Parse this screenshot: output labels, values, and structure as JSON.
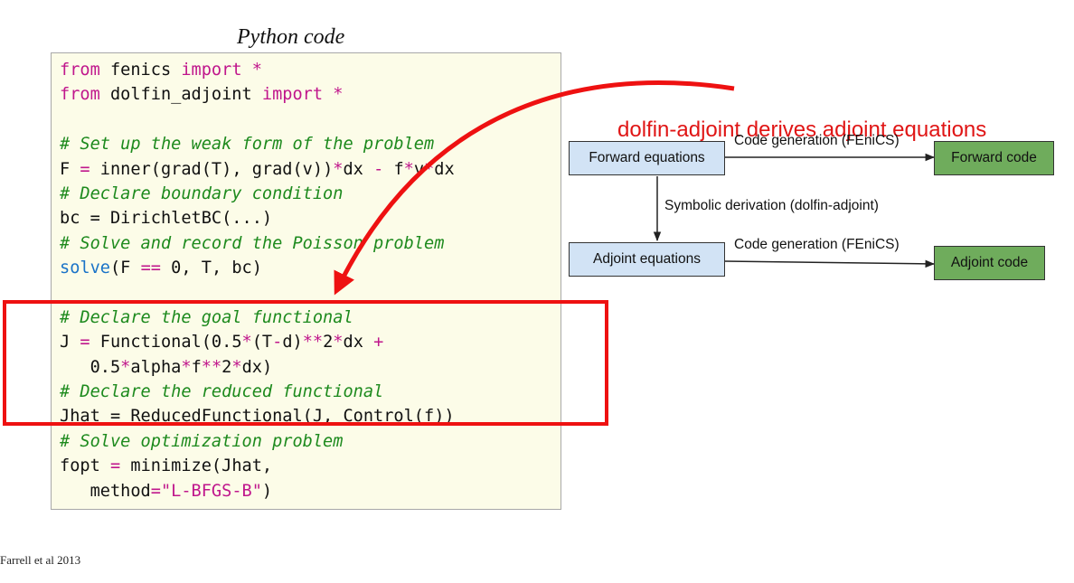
{
  "code_title": "Python code",
  "code_lines": [
    "from fenics import *",
    "from dolfin_adjoint import *",
    "",
    "# Set up the weak form of the problem",
    "F = inner(grad(T), grad(v))*dx - f*v*dx",
    "# Declare boundary condition",
    "bc = DirichletBC(...)",
    "# Solve and record the Poisson problem",
    "solve(F == 0, T, bc)",
    "",
    "# Declare the goal functional",
    "J = Functional(0.5*(T-d)**2*dx +",
    "   0.5*alpha*f**2*dx)",
    "# Declare the reduced functional",
    "Jhat = ReducedFunctional(J, Control(f))",
    "# Solve optimization problem",
    "fopt = minimize(Jhat,",
    "   method=\"L-BFGS-B\")"
  ],
  "annotation": "dolfin-adjoint derives adjoint equations",
  "diagram": {
    "forward_equations": "Forward equations",
    "forward_code": "Forward code",
    "adjoint_equations": "Adjoint equations",
    "adjoint_code": "Adjoint code",
    "edge_forward": "Code generation (FEniCS)",
    "edge_adjoint": "Code generation (FEniCS)",
    "edge_derivation": "Symbolic derivation (dolfin-adjoint)"
  },
  "citation": "Farrell et al 2013",
  "colors": {
    "highlight": "#ee1111",
    "keyword": "#c0168c",
    "comment": "#1d8a1d",
    "function": "#1a73c8",
    "blue_node": "#d2e3f5",
    "green_node": "#6fac5c"
  }
}
